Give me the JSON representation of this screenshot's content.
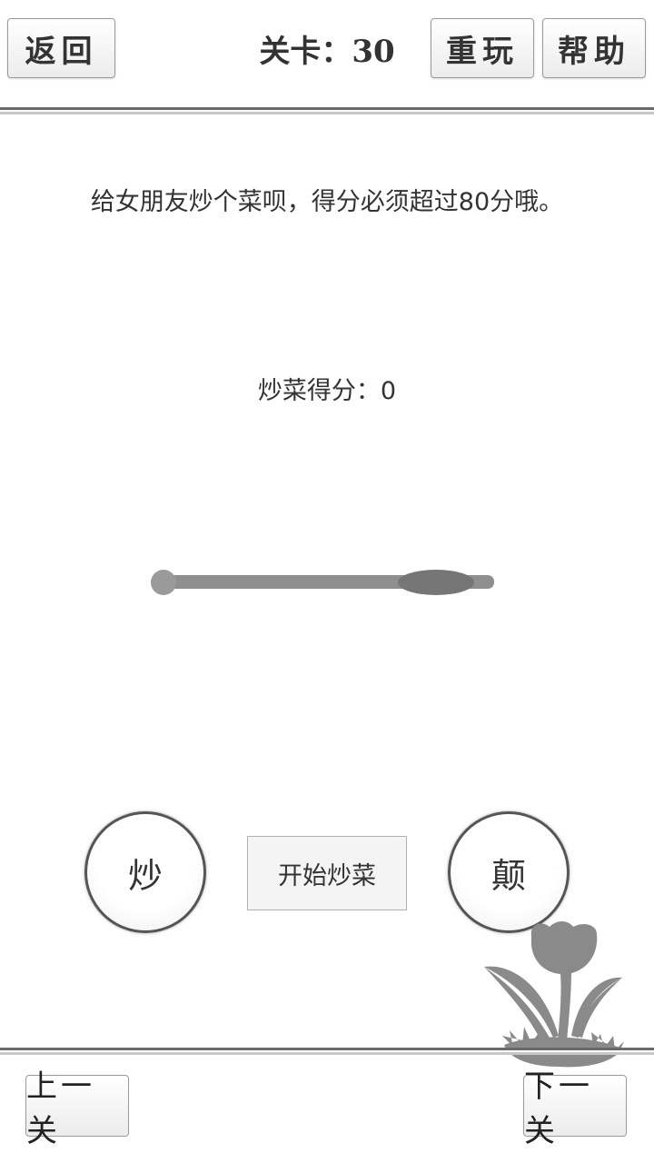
{
  "header": {
    "back_label": "返回",
    "level_label": "关卡：30",
    "replay_label": "重玩",
    "help_label": "帮助"
  },
  "instruction": "给女朋友炒个菜呗，得分必须超过80分哦。",
  "score": {
    "label": "炒菜得分：",
    "value": "0"
  },
  "controls": {
    "stir_label": "炒",
    "start_label": "开始炒菜",
    "toss_label": "颠"
  },
  "footer": {
    "prev_label": "上一关",
    "next_label": "下一关"
  },
  "colors": {
    "pan": "#8f8f8f",
    "food": "#767676",
    "tulip": "#8a8a8a"
  }
}
